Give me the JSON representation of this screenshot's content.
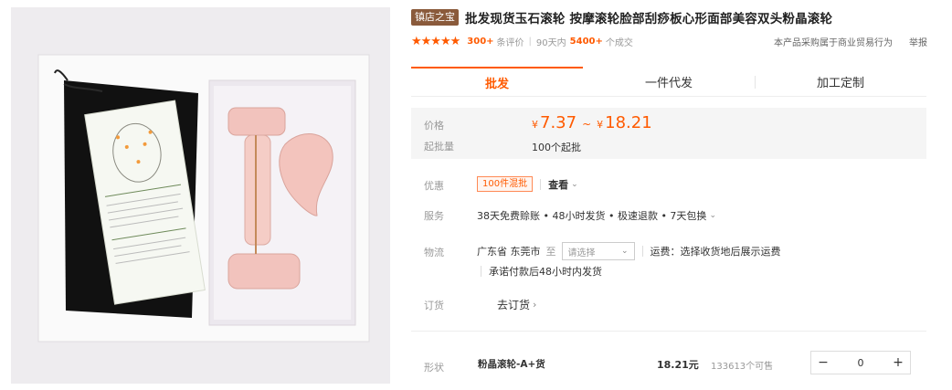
{
  "header": {
    "shop_badge": "镇店之宝",
    "title": "批发现货玉石滚轮 按摩滚轮脸部刮痧板心形面部美容双头粉晶滚轮"
  },
  "rating": {
    "stars": "★★★★★",
    "review_count": "300+",
    "review_label": "条评价",
    "period_label": "90天内",
    "sold_count": "5400+",
    "sold_label": "个成交",
    "business_note": "本产品采购属于商业贸易行为",
    "report_label": "举报"
  },
  "tabs": [
    {
      "label": "批发",
      "active": true
    },
    {
      "label": "一件代发",
      "active": false
    },
    {
      "label": "加工定制",
      "active": false
    }
  ],
  "price": {
    "label": "价格",
    "currency": "¥",
    "low": "7.37",
    "separator": "~",
    "high": "18.21",
    "min_batch_label": "起批量",
    "min_batch_value": "100个起批"
  },
  "promotion": {
    "label": "优惠",
    "tag": "100件混批",
    "view_label": "查看"
  },
  "service": {
    "label": "服务",
    "text": "38天免费赊账 • 48小时发货 • 极速退款 • 7天包换"
  },
  "logistics": {
    "label": "物流",
    "origin": "广东省 东莞市",
    "to_label": "至",
    "select_placeholder": "请选择",
    "freight_text": "运费：选择收货地后展示运费",
    "promise_text": "承诺付款后48小时内发货"
  },
  "order": {
    "label": "订货",
    "action": "去订货"
  },
  "sku": {
    "label": "形状",
    "name": "粉晶滚轮-A+货",
    "price": "18.21元",
    "stock": "133613个可售",
    "minus": "−",
    "quantity": "0",
    "plus": "+"
  },
  "image_text": {
    "card_heading": "",
    "colors": {
      "rose": "#f2c3bd",
      "box": "#ffffff",
      "pouch": "#111111",
      "accent": "#ff5a00"
    }
  }
}
